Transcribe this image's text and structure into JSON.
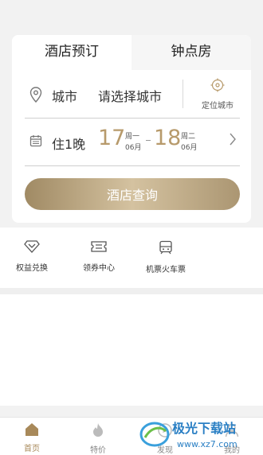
{
  "tabs": {
    "hotel": "酒店预订",
    "hourly": "钟点房"
  },
  "city": {
    "label": "城市",
    "placeholder": "请选择城市",
    "locate_label": "定位城市"
  },
  "dates": {
    "nights": "住1晚",
    "checkin_day": "17",
    "checkin_weekday": "周一",
    "checkin_month": "06月",
    "checkout_day": "18",
    "checkout_weekday": "周二",
    "checkout_month": "06月"
  },
  "search_button": "酒店查询",
  "quick_links": [
    {
      "label": "权益兑换",
      "icon": "diamond-icon"
    },
    {
      "label": "领券中心",
      "icon": "ticket-icon"
    },
    {
      "label": "机票火车票",
      "icon": "train-icon"
    }
  ],
  "tabbar": [
    {
      "label": "首页",
      "icon": "home-icon"
    },
    {
      "label": "特价",
      "icon": "flame-icon"
    },
    {
      "label": "发现",
      "icon": "discover-icon"
    },
    {
      "label": "我的",
      "icon": "profile-icon"
    }
  ],
  "watermark": {
    "text": "极光下载站",
    "url": "www.xz7.com"
  },
  "colors": {
    "accent": "#b79a6b",
    "background": "#f2f2f2"
  }
}
